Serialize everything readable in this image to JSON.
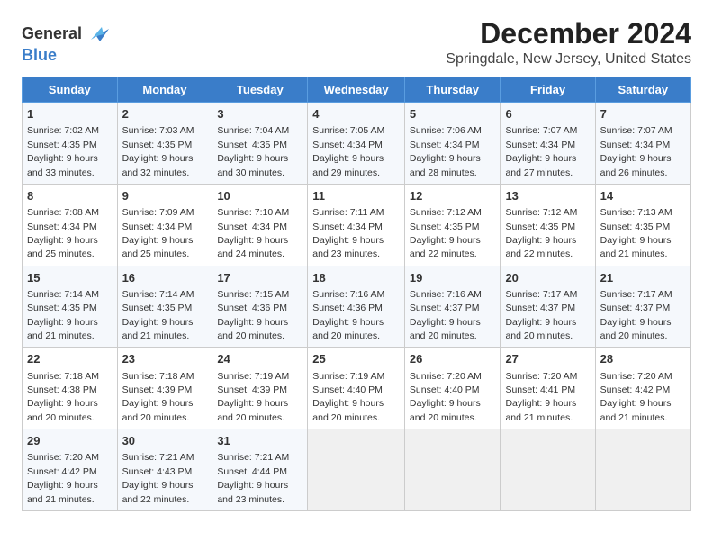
{
  "logo": {
    "text1": "General",
    "text2": "Blue"
  },
  "title": "December 2024",
  "subtitle": "Springdale, New Jersey, United States",
  "weekdays": [
    "Sunday",
    "Monday",
    "Tuesday",
    "Wednesday",
    "Thursday",
    "Friday",
    "Saturday"
  ],
  "weeks": [
    [
      {
        "day": "1",
        "sunrise": "7:02 AM",
        "sunset": "4:35 PM",
        "daylight": "9 hours and 33 minutes."
      },
      {
        "day": "2",
        "sunrise": "7:03 AM",
        "sunset": "4:35 PM",
        "daylight": "9 hours and 32 minutes."
      },
      {
        "day": "3",
        "sunrise": "7:04 AM",
        "sunset": "4:35 PM",
        "daylight": "9 hours and 30 minutes."
      },
      {
        "day": "4",
        "sunrise": "7:05 AM",
        "sunset": "4:34 PM",
        "daylight": "9 hours and 29 minutes."
      },
      {
        "day": "5",
        "sunrise": "7:06 AM",
        "sunset": "4:34 PM",
        "daylight": "9 hours and 28 minutes."
      },
      {
        "day": "6",
        "sunrise": "7:07 AM",
        "sunset": "4:34 PM",
        "daylight": "9 hours and 27 minutes."
      },
      {
        "day": "7",
        "sunrise": "7:07 AM",
        "sunset": "4:34 PM",
        "daylight": "9 hours and 26 minutes."
      }
    ],
    [
      {
        "day": "8",
        "sunrise": "7:08 AM",
        "sunset": "4:34 PM",
        "daylight": "9 hours and 25 minutes."
      },
      {
        "day": "9",
        "sunrise": "7:09 AM",
        "sunset": "4:34 PM",
        "daylight": "9 hours and 25 minutes."
      },
      {
        "day": "10",
        "sunrise": "7:10 AM",
        "sunset": "4:34 PM",
        "daylight": "9 hours and 24 minutes."
      },
      {
        "day": "11",
        "sunrise": "7:11 AM",
        "sunset": "4:34 PM",
        "daylight": "9 hours and 23 minutes."
      },
      {
        "day": "12",
        "sunrise": "7:12 AM",
        "sunset": "4:35 PM",
        "daylight": "9 hours and 22 minutes."
      },
      {
        "day": "13",
        "sunrise": "7:12 AM",
        "sunset": "4:35 PM",
        "daylight": "9 hours and 22 minutes."
      },
      {
        "day": "14",
        "sunrise": "7:13 AM",
        "sunset": "4:35 PM",
        "daylight": "9 hours and 21 minutes."
      }
    ],
    [
      {
        "day": "15",
        "sunrise": "7:14 AM",
        "sunset": "4:35 PM",
        "daylight": "9 hours and 21 minutes."
      },
      {
        "day": "16",
        "sunrise": "7:14 AM",
        "sunset": "4:35 PM",
        "daylight": "9 hours and 21 minutes."
      },
      {
        "day": "17",
        "sunrise": "7:15 AM",
        "sunset": "4:36 PM",
        "daylight": "9 hours and 20 minutes."
      },
      {
        "day": "18",
        "sunrise": "7:16 AM",
        "sunset": "4:36 PM",
        "daylight": "9 hours and 20 minutes."
      },
      {
        "day": "19",
        "sunrise": "7:16 AM",
        "sunset": "4:37 PM",
        "daylight": "9 hours and 20 minutes."
      },
      {
        "day": "20",
        "sunrise": "7:17 AM",
        "sunset": "4:37 PM",
        "daylight": "9 hours and 20 minutes."
      },
      {
        "day": "21",
        "sunrise": "7:17 AM",
        "sunset": "4:37 PM",
        "daylight": "9 hours and 20 minutes."
      }
    ],
    [
      {
        "day": "22",
        "sunrise": "7:18 AM",
        "sunset": "4:38 PM",
        "daylight": "9 hours and 20 minutes."
      },
      {
        "day": "23",
        "sunrise": "7:18 AM",
        "sunset": "4:39 PM",
        "daylight": "9 hours and 20 minutes."
      },
      {
        "day": "24",
        "sunrise": "7:19 AM",
        "sunset": "4:39 PM",
        "daylight": "9 hours and 20 minutes."
      },
      {
        "day": "25",
        "sunrise": "7:19 AM",
        "sunset": "4:40 PM",
        "daylight": "9 hours and 20 minutes."
      },
      {
        "day": "26",
        "sunrise": "7:20 AM",
        "sunset": "4:40 PM",
        "daylight": "9 hours and 20 minutes."
      },
      {
        "day": "27",
        "sunrise": "7:20 AM",
        "sunset": "4:41 PM",
        "daylight": "9 hours and 21 minutes."
      },
      {
        "day": "28",
        "sunrise": "7:20 AM",
        "sunset": "4:42 PM",
        "daylight": "9 hours and 21 minutes."
      }
    ],
    [
      {
        "day": "29",
        "sunrise": "7:20 AM",
        "sunset": "4:42 PM",
        "daylight": "9 hours and 21 minutes."
      },
      {
        "day": "30",
        "sunrise": "7:21 AM",
        "sunset": "4:43 PM",
        "daylight": "9 hours and 22 minutes."
      },
      {
        "day": "31",
        "sunrise": "7:21 AM",
        "sunset": "4:44 PM",
        "daylight": "9 hours and 23 minutes."
      },
      null,
      null,
      null,
      null
    ]
  ]
}
